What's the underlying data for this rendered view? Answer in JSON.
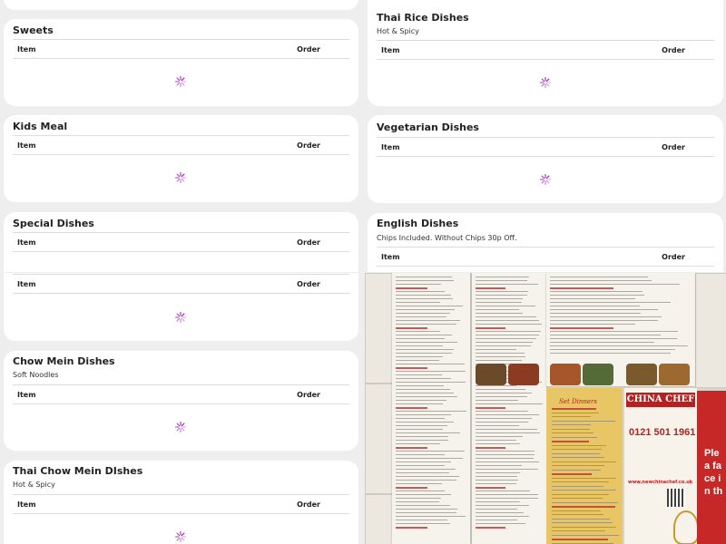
{
  "table": {
    "col_item": "Item",
    "col_order": "Order"
  },
  "categories_left_top": [
    {
      "title": "Sweets",
      "subtitle": ""
    },
    {
      "title": "Kids Meal",
      "subtitle": ""
    },
    {
      "title": "Special Dishes",
      "subtitle": ""
    }
  ],
  "categories_right_top": [
    {
      "title": "Thai Rice Dishes",
      "subtitle": "Hot & Spicy"
    },
    {
      "title": "Vegetarian Dishes",
      "subtitle": ""
    },
    {
      "title": "English Dishes",
      "subtitle": "Chips Included. Without Chips 30p Off."
    }
  ],
  "categories_left_bottom": [
    {
      "title": "",
      "subtitle": ""
    },
    {
      "title": "Chow Mein Dishes",
      "subtitle": "Soft Noodles"
    },
    {
      "title": "Thai Chow Mein DIshes",
      "subtitle": "Hot & Spicy"
    }
  ],
  "photo": {
    "restaurant_name": "CHINA CHEF",
    "phone": "0121 501 1961",
    "website": "www.newchinachef.co.uk",
    "section_set_dinners": "Set Dinners",
    "sign_partial": "Plea face in th"
  },
  "colors": {
    "spinner": "#9c27b0",
    "brand_red": "#b81f1f"
  }
}
